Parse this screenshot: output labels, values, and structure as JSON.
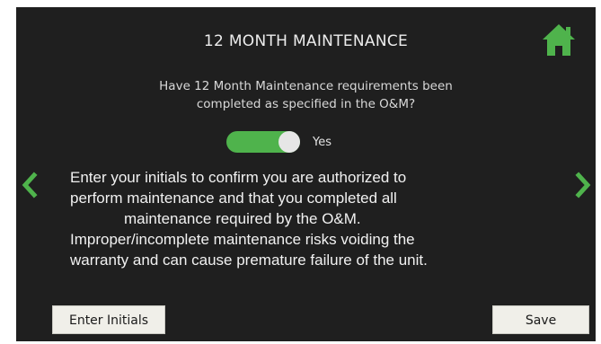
{
  "header": {
    "title": "12 MONTH MAINTENANCE",
    "home_icon": "home-icon"
  },
  "question": {
    "line1": "Have 12 Month Maintenance requirements been",
    "line2": "completed as specified in the O&M?"
  },
  "toggle": {
    "state": "on",
    "label": "Yes"
  },
  "message": {
    "line1": "Enter your initials to confirm you are authorized to",
    "line2": "perform maintenance and that you completed all",
    "line3": "maintenance required by the O&M.",
    "line4": "Improper/incomplete maintenance risks voiding the",
    "line5": "warranty and can cause premature failure of the unit."
  },
  "buttons": {
    "initials_label": "Enter Initials",
    "save_label": "Save"
  },
  "colors": {
    "background": "#1f1f1f",
    "accent_green": "#4fb34c",
    "button_bg": "#f0efe9"
  }
}
